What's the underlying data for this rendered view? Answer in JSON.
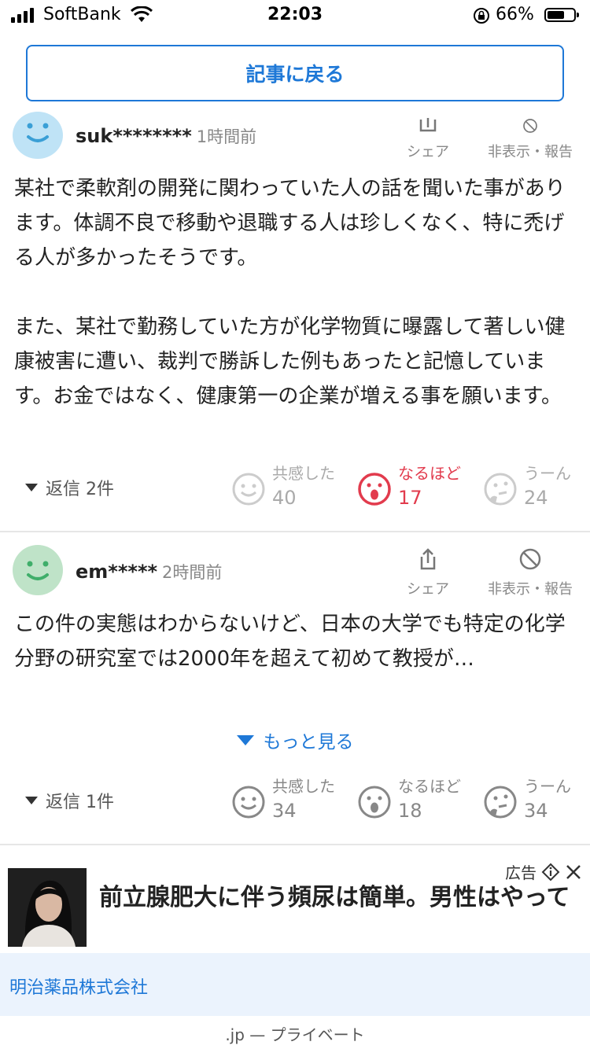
{
  "status_bar": {
    "carrier": "SoftBank",
    "time": "22:03",
    "battery_percent": "66%",
    "battery_level": 0.66
  },
  "back_button": {
    "label": "記事に戻る"
  },
  "colors": {
    "accent": "#1e78d7",
    "naruhodo_active": "#e23b4d",
    "avatar_blue": "#bfe3f6",
    "avatar_green": "#bfe3c8"
  },
  "comments": [
    {
      "username": "suk********",
      "time": "1時間前",
      "share_label": "シェア",
      "hide_report_label": "非表示・報告",
      "body": "某社で柔軟剤の開発に関わっていた人の話を聞いた事があります。体調不良で移動や退職する人は珍しくなく、特に禿げる人が多かったそうです。\n\nまた、某社で勤務していた方が化学物質に曝露して著しい健康被害に遭い、裁判で勝訴した例もあったと記憶しています。お金ではなく、健康第一の企業が増える事を願います。",
      "replies": "返信 2件",
      "reactions": [
        {
          "label": "共感した",
          "count": "40",
          "icon": "smile-icon"
        },
        {
          "label": "なるほど",
          "count": "17",
          "icon": "surprised-icon"
        },
        {
          "label": "うーん",
          "count": "24",
          "icon": "thinking-icon"
        }
      ]
    },
    {
      "username": "em*****",
      "time": "2時間前",
      "share_label": "シェア",
      "hide_report_label": "非表示・報告",
      "body": "この件の実態はわからないけど、日本の大学でも特定の化学分野の研究室では2000年を超えて初めて教授が…",
      "more_label": "もっと見る",
      "replies": "返信 1件",
      "reactions": [
        {
          "label": "共感した",
          "count": "34",
          "icon": "smile-icon"
        },
        {
          "label": "なるほど",
          "count": "18",
          "icon": "surprised-icon"
        },
        {
          "label": "うーん",
          "count": "34",
          "icon": "thinking-icon"
        }
      ]
    }
  ],
  "ad": {
    "label": "広告",
    "headline": "前立腺肥大に伴う頻尿は簡単。男性はやって",
    "sponsor": "明治薬品株式会社"
  },
  "footer": {
    "text": ".jp — プライベート"
  }
}
